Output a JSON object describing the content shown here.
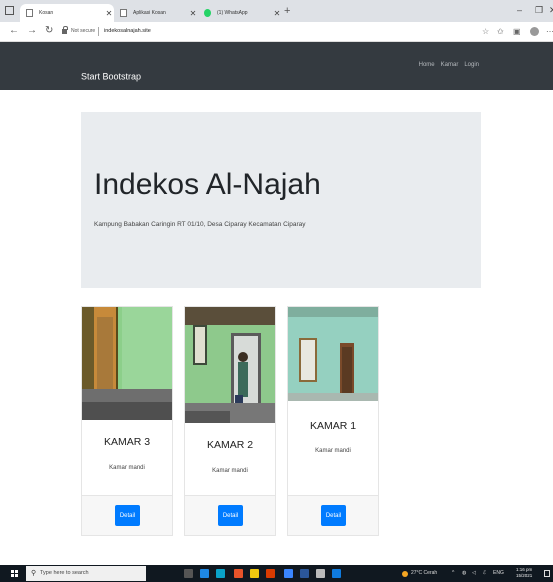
{
  "browser": {
    "tabs": [
      {
        "title": "Kosan",
        "active": true
      },
      {
        "title": "Aplikasi Kosan",
        "active": false
      },
      {
        "title": "(1) WhatsApp",
        "active": false
      }
    ],
    "new_tab_glyph": "+",
    "address": {
      "security_label": "Not secure",
      "url": "indekosalnajah.site"
    },
    "icons": [
      "back-icon",
      "forward-icon",
      "reload-icon",
      "star-icon",
      "extensions-icon",
      "collections-icon",
      "profile-icon",
      "more-icon"
    ]
  },
  "navbar": {
    "brand": "Start Bootstrap",
    "links": [
      "Home",
      "Kamar",
      "Login"
    ]
  },
  "jumbotron": {
    "title": "Indekos Al-Najah",
    "lead": "Kampung Babakan Caringin RT 01/10, Desa Ciparay Kecamatan Ciparay"
  },
  "cards": [
    {
      "title": "KAMAR 3",
      "text": "Kamar mandi",
      "button": "Detail"
    },
    {
      "title": "KAMAR 2",
      "text": "Kamar mandi",
      "button": "Detail"
    },
    {
      "title": "KAMAR 1",
      "text": "Kamar mandi",
      "button": "Detail"
    }
  ],
  "taskbar": {
    "search_placeholder": "Type here to search",
    "weather": "27°C Cerah",
    "language": "ENG",
    "time": "1:16 pm",
    "date": "15/2021"
  },
  "colors": {
    "navbar_bg": "#343a40",
    "jumbotron_bg": "#e9ecef",
    "button_primary": "#007bff",
    "wall_green": "#8fcf8f"
  }
}
